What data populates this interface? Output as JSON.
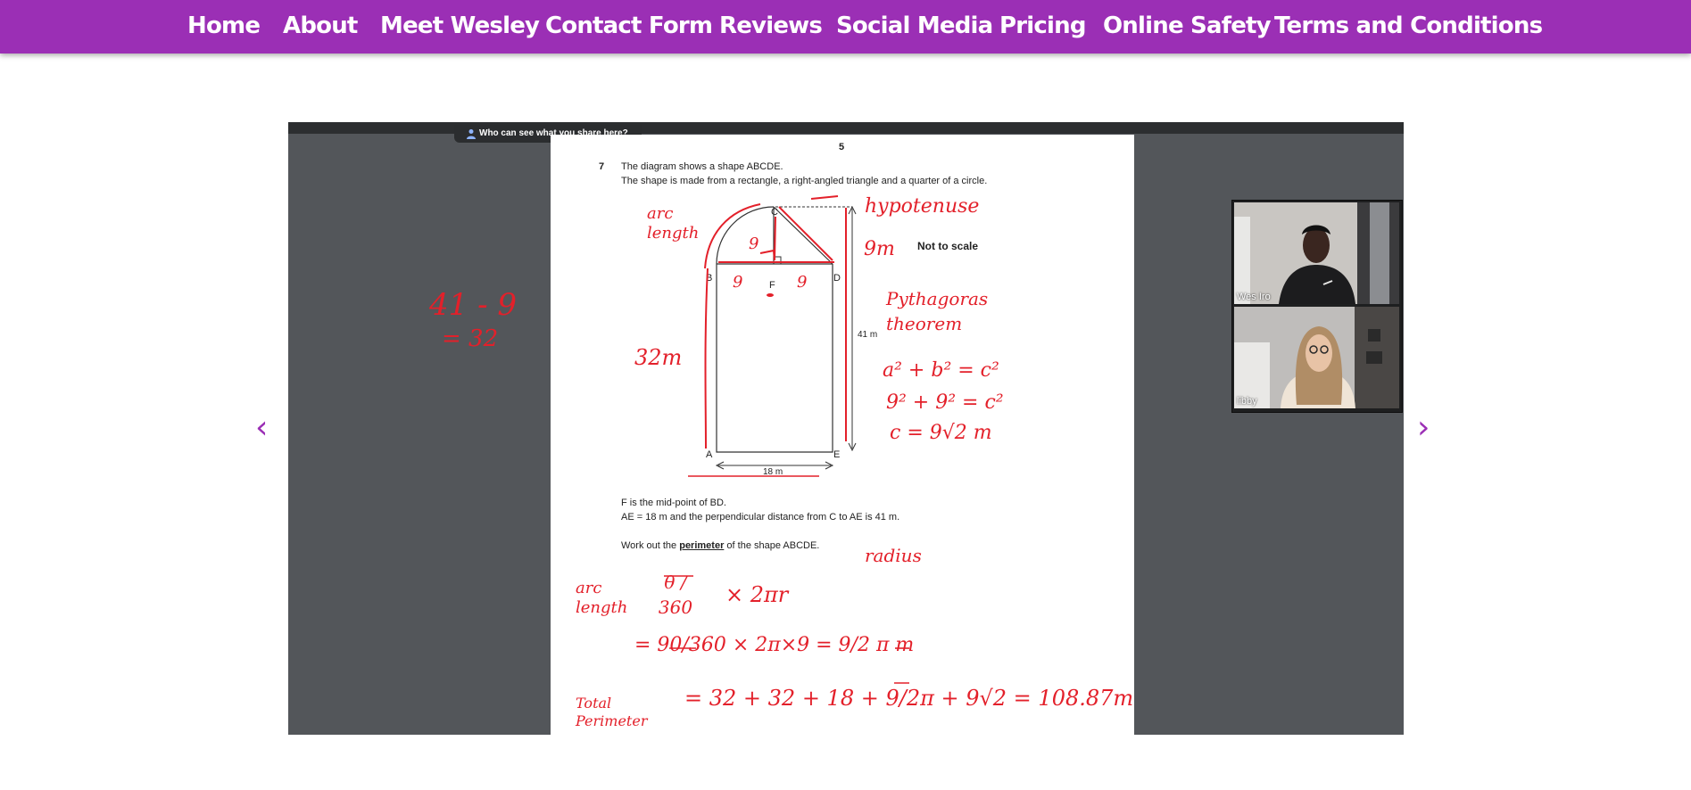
{
  "nav": {
    "items": [
      {
        "label": "Home"
      },
      {
        "label": "About"
      },
      {
        "label": "Meet Wesley"
      },
      {
        "label": "Contact Form"
      },
      {
        "label": "Reviews"
      },
      {
        "label": "Social Media"
      },
      {
        "label": "Pricing"
      },
      {
        "label": "Online Safety"
      },
      {
        "label": "Terms and Conditions"
      }
    ]
  },
  "slider": {
    "prev_icon": "‹",
    "next_icon": "›",
    "share_banner": "Who can see what you share here?",
    "worksheet": {
      "page_number": "5",
      "question_number": "7",
      "line1": "The diagram shows a shape ABCDE.",
      "line2": "The shape is made from a rectangle, a right-angled triangle and a quarter of a circle.",
      "not_to_scale": "Not to scale",
      "dim_41": "41 m",
      "dim_18": "18 m",
      "labels": {
        "A": "A",
        "B": "B",
        "C": "C",
        "D": "D",
        "E": "E",
        "F": "F"
      },
      "info1": "F is the mid-point of BD.",
      "info2": "AE = 18 m and the perpendicular distance from C to AE is 41 m.",
      "task_pre": "Work out the ",
      "task_bold": "perimeter",
      "task_post": " of the shape ABCDE."
    },
    "annotations": {
      "arc_length": "arc length",
      "nine_q": "9",
      "hypotenuse": "hypotenuse",
      "nine_m": "9m",
      "nine_left": "9",
      "nine_right": "9",
      "thirtytwo": "32m",
      "pythagoras": "Pythagoras theorem",
      "eq1": "a² + b² = c²",
      "eq2": "9² + 9² = c²",
      "eq3": "c = 9√2 m",
      "radius": "radius",
      "arc_label": "arc length",
      "theta_frac": "θ / 360",
      "two_pi_r": "× 2πr",
      "step2": "= 90/360 × 2π×9 = 9/2 π m",
      "total_label": "Total Perimeter",
      "total_eq": "= 32 + 32 + 18 + 9/2π + 9√2 = 108.87m",
      "side_calc1": "41 - 9",
      "side_calc2": "= 32"
    },
    "video_tiles": [
      {
        "name": "Wes Iro"
      },
      {
        "name": "libby"
      }
    ]
  }
}
